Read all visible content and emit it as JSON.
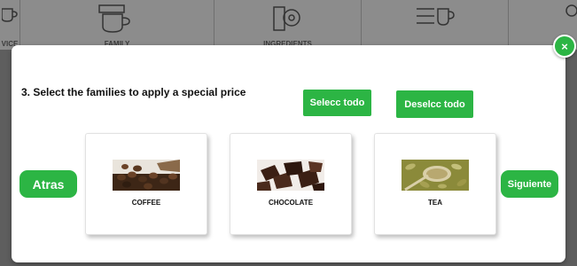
{
  "background": {
    "tabs": [
      {
        "label": "VICE"
      },
      {
        "label": "FAMILY"
      },
      {
        "label": "INGREDIENTS"
      },
      {
        "label": ""
      },
      {
        "label": ""
      }
    ]
  },
  "modal": {
    "title": "3. Select the families to apply a special price",
    "close_label": "×",
    "select_all_label": "Selecc todo",
    "deselect_all_label": "Deselcc todo",
    "back_label": "Atras",
    "next_label": "Siguiente",
    "families": [
      {
        "label": "COFFEE",
        "icon": "coffee-beans-image"
      },
      {
        "label": "CHOCOLATE",
        "icon": "chocolate-image"
      },
      {
        "label": "TEA",
        "icon": "tea-leaves-image"
      }
    ]
  },
  "colors": {
    "accent": "#2cb544",
    "overlay": "#5a5a5a",
    "modal_bg": "#ffffff"
  }
}
